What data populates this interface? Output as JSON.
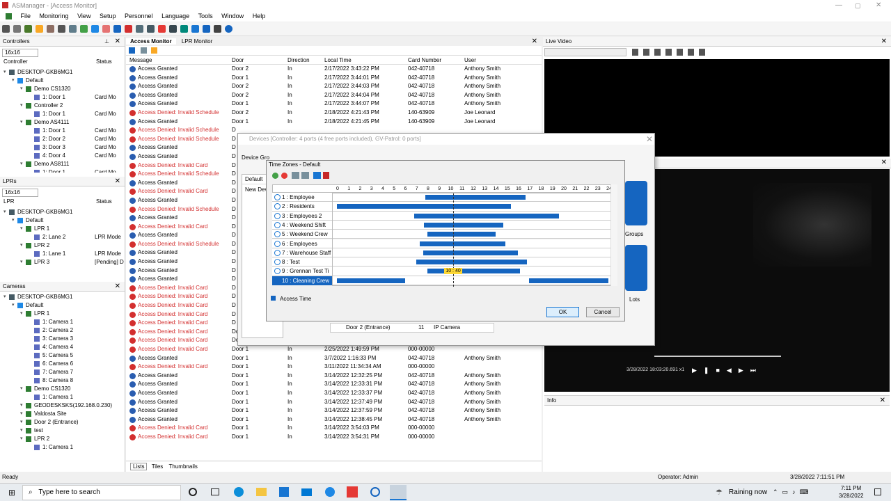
{
  "app": {
    "title": "ASManager - [Access Monitor]"
  },
  "menu": [
    "File",
    "Monitoring",
    "View",
    "Setup",
    "Personnel",
    "Language",
    "Tools",
    "Window",
    "Help"
  ],
  "controllers": {
    "title": "Controllers",
    "size": "16x16",
    "col_controller": "Controller",
    "col_status": "Status",
    "rows": [
      {
        "t": "DESKTOP-GKB6MG1",
        "s": "",
        "l": 0
      },
      {
        "t": "Default",
        "s": "",
        "l": 1
      },
      {
        "t": "Demo CS1320",
        "s": "",
        "l": 2
      },
      {
        "t": "1: Door 1",
        "s": "Card Mo",
        "l": 3
      },
      {
        "t": "Controller 2",
        "s": "",
        "l": 2
      },
      {
        "t": "1: Door 1",
        "s": "Card Mo",
        "l": 3
      },
      {
        "t": "Demo AS4111",
        "s": "",
        "l": 2
      },
      {
        "t": "1: Door 1",
        "s": "Card Mo",
        "l": 3
      },
      {
        "t": "2: Door 2",
        "s": "Card Mo",
        "l": 3
      },
      {
        "t": "3: Door 3",
        "s": "Card Mo",
        "l": 3
      },
      {
        "t": "4: Door 4",
        "s": "Card Mo",
        "l": 3
      },
      {
        "t": "Demo AS8111",
        "s": "",
        "l": 2
      },
      {
        "t": "1: Door 1",
        "s": "Card Mo",
        "l": 3
      }
    ]
  },
  "lprs": {
    "title": "LPRs",
    "size": "16x16",
    "col_lpr": "LPR",
    "col_status": "Status",
    "rows": [
      {
        "t": "DESKTOP-GKB6MG1",
        "s": "",
        "l": 0
      },
      {
        "t": "Default",
        "s": "",
        "l": 1
      },
      {
        "t": "LPR 1",
        "s": "",
        "l": 2
      },
      {
        "t": "2: Lane 2",
        "s": "LPR Mode",
        "l": 3
      },
      {
        "t": "LPR 2",
        "s": "",
        "l": 2
      },
      {
        "t": "1: Lane 1",
        "s": "LPR Mode",
        "l": 3
      },
      {
        "t": "LPR 3",
        "s": "[Pending] D",
        "l": 2
      }
    ]
  },
  "cameras": {
    "title": "Cameras",
    "rows": [
      {
        "t": "DESKTOP-GKB6MG1",
        "l": 0
      },
      {
        "t": "Default",
        "l": 1
      },
      {
        "t": "LPR 1",
        "l": 2
      },
      {
        "t": "1: Camera 1",
        "l": 3
      },
      {
        "t": "2: Camera 2",
        "l": 3
      },
      {
        "t": "3: Camera 3",
        "l": 3
      },
      {
        "t": "4: Camera 4",
        "l": 3
      },
      {
        "t": "5: Camera 5",
        "l": 3
      },
      {
        "t": "6: Camera 6",
        "l": 3
      },
      {
        "t": "7: Camera 7",
        "l": 3
      },
      {
        "t": "8: Camera 8",
        "l": 3
      },
      {
        "t": "Demo CS1320",
        "l": 2
      },
      {
        "t": "1: Camera 1",
        "l": 3
      },
      {
        "t": "GEODESKSKS(192.168.0.230)",
        "l": 2
      },
      {
        "t": "Valdosta Site",
        "l": 2
      },
      {
        "t": "Door 2 (Entrance)",
        "l": 2
      },
      {
        "t": "test",
        "l": 2
      },
      {
        "t": "LPR 2",
        "l": 2
      },
      {
        "t": "1: Camera 1",
        "l": 3
      }
    ]
  },
  "monitor": {
    "tab1": "Access Monitor",
    "tab2": "LPR Monitor",
    "cols": [
      "Message",
      "Door",
      "Direction",
      "Local Time",
      "Card Number",
      "User"
    ],
    "rows": [
      [
        "ok",
        "Access Granted",
        "Door 2",
        "In",
        "2/17/2022 3:43:22 PM",
        "042-40718",
        "Anthony Smith"
      ],
      [
        "ok",
        "Access Granted",
        "Door 1",
        "In",
        "2/17/2022 3:44:01 PM",
        "042-40718",
        "Anthony Smith"
      ],
      [
        "ok",
        "Access Granted",
        "Door 2",
        "In",
        "2/17/2022 3:44:03 PM",
        "042-40718",
        "Anthony Smith"
      ],
      [
        "ok",
        "Access Granted",
        "Door 2",
        "In",
        "2/17/2022 3:44:04 PM",
        "042-40718",
        "Anthony Smith"
      ],
      [
        "ok",
        "Access Granted",
        "Door 1",
        "In",
        "2/17/2022 3:44:07 PM",
        "042-40718",
        "Anthony Smith"
      ],
      [
        "bad",
        "Access Denied: Invalid Schedule",
        "Door 2",
        "In",
        "2/18/2022 4:21:43 PM",
        "140-63909",
        "Joe Leonard"
      ],
      [
        "ok",
        "Access Granted",
        "Door 1",
        "In",
        "2/18/2022 4:21:45 PM",
        "140-63909",
        "Joe Leonard"
      ],
      [
        "bad",
        "Access Denied: Invalid Schedule",
        "D",
        "",
        "",
        "",
        ""
      ],
      [
        "bad",
        "Access Denied: Invalid Schedule",
        "D",
        "",
        "",
        "",
        ""
      ],
      [
        "ok",
        "Access Granted",
        "D",
        "",
        "",
        "",
        ""
      ],
      [
        "ok",
        "Access Granted",
        "D",
        "",
        "",
        "",
        ""
      ],
      [
        "bad",
        "Access Denied: Invalid Card",
        "D",
        "",
        "",
        "",
        ""
      ],
      [
        "bad",
        "Access Denied: Invalid Schedule",
        "D",
        "",
        "",
        "",
        ""
      ],
      [
        "ok",
        "Access Granted",
        "D",
        "",
        "",
        "",
        ""
      ],
      [
        "bad",
        "Access Denied: Invalid Card",
        "D",
        "",
        "",
        "",
        ""
      ],
      [
        "ok",
        "Access Granted",
        "D",
        "",
        "",
        "",
        ""
      ],
      [
        "bad",
        "Access Denied: Invalid Schedule",
        "D",
        "",
        "",
        "",
        ""
      ],
      [
        "ok",
        "Access Granted",
        "D",
        "",
        "",
        "",
        ""
      ],
      [
        "bad",
        "Access Denied: Invalid Card",
        "D",
        "",
        "",
        "",
        ""
      ],
      [
        "ok",
        "Access Granted",
        "D",
        "",
        "",
        "",
        ""
      ],
      [
        "bad",
        "Access Denied: Invalid Schedule",
        "D",
        "",
        "",
        "",
        ""
      ],
      [
        "ok",
        "Access Granted",
        "D",
        "",
        "",
        "",
        ""
      ],
      [
        "ok",
        "Access Granted",
        "D",
        "",
        "",
        "",
        ""
      ],
      [
        "ok",
        "Access Granted",
        "D",
        "",
        "",
        "",
        ""
      ],
      [
        "ok",
        "Access Granted",
        "D",
        "",
        "",
        "",
        ""
      ],
      [
        "bad",
        "Access Denied: Invalid Card",
        "D",
        "",
        "",
        "",
        ""
      ],
      [
        "bad",
        "Access Denied: Invalid Card",
        "D",
        "",
        "",
        "",
        ""
      ],
      [
        "bad",
        "Access Denied: Invalid Card",
        "D",
        "",
        "",
        "",
        ""
      ],
      [
        "bad",
        "Access Denied: Invalid Card",
        "D",
        "",
        "",
        "",
        ""
      ],
      [
        "bad",
        "Access Denied: Invalid Card",
        "D",
        "",
        "",
        "",
        ""
      ],
      [
        "bad",
        "Access Denied: Invalid Card",
        "Door 1",
        "In",
        "2/25/2022 11:59:00 AM",
        "000-00000",
        ""
      ],
      [
        "bad",
        "Access Denied: Invalid Card",
        "Door 1",
        "In",
        "2/25/2022 1:49:50 PM",
        "000-00000",
        ""
      ],
      [
        "bad",
        "Access Denied: Invalid Card",
        "Door 1",
        "In",
        "2/25/2022 1:49:59 PM",
        "000-00000",
        ""
      ],
      [
        "ok",
        "Access Granted",
        "Door 1",
        "In",
        "3/7/2022 1:16:33 PM",
        "042-40718",
        "Anthony Smith"
      ],
      [
        "bad",
        "Access Denied: Invalid Card",
        "Door 1",
        "In",
        "3/11/2022 11:34:34 AM",
        "000-00000",
        ""
      ],
      [
        "ok",
        "Access Granted",
        "Door 1",
        "In",
        "3/14/2022 12:32:25 PM",
        "042-40718",
        "Anthony Smith"
      ],
      [
        "ok",
        "Access Granted",
        "Door 1",
        "In",
        "3/14/2022 12:33:31 PM",
        "042-40718",
        "Anthony Smith"
      ],
      [
        "ok",
        "Access Granted",
        "Door 1",
        "In",
        "3/14/2022 12:33:37 PM",
        "042-40718",
        "Anthony Smith"
      ],
      [
        "ok",
        "Access Granted",
        "Door 1",
        "In",
        "3/14/2022 12:37:49 PM",
        "042-40718",
        "Anthony Smith"
      ],
      [
        "ok",
        "Access Granted",
        "Door 1",
        "In",
        "3/14/2022 12:37:59 PM",
        "042-40718",
        "Anthony Smith"
      ],
      [
        "ok",
        "Access Granted",
        "Door 1",
        "In",
        "3/14/2022 12:38:45 PM",
        "042-40718",
        "Anthony Smith"
      ],
      [
        "bad",
        "Access Denied: Invalid Card",
        "Door 1",
        "In",
        "3/14/2022 3:54:03 PM",
        "000-00000",
        ""
      ],
      [
        "bad",
        "Access Denied: Invalid Card",
        "Door 1",
        "In",
        "3/14/2022 3:54:31 PM",
        "000-00000",
        ""
      ]
    ],
    "bottom_tabs": [
      "Lists",
      "Tiles",
      "Thumbnails"
    ]
  },
  "devices": {
    "title": "Devices  [Controller: 4 ports (4 free ports included), GV-Patrol: 0 ports]",
    "device_group": "Device Gro",
    "default": "Default",
    "new_device": "New Devic",
    "groups_label": "Groups",
    "lots_label": "Lots",
    "row_device": "Door 2 (Entrance)",
    "row_num": "11",
    "row_type": "IP Camera"
  },
  "timezones": {
    "title": "Time Zones - Default",
    "hours": [
      "0",
      "1",
      "2",
      "3",
      "4",
      "5",
      "6",
      "7",
      "8",
      "9",
      "10",
      "11",
      "12",
      "13",
      "14",
      "15",
      "16",
      "17",
      "18",
      "19",
      "20",
      "21",
      "22",
      "23",
      "24"
    ],
    "now_label": "10 : 40",
    "rows": [
      {
        "label": "1 : Employee",
        "ranges": [
          [
            7.8,
            16.7
          ]
        ]
      },
      {
        "label": "2 : Residents",
        "ranges": [
          [
            0,
            15.4
          ]
        ]
      },
      {
        "label": "3 : Employees 2",
        "ranges": [
          [
            6.8,
            19.6
          ]
        ]
      },
      {
        "label": "4 : Weekend Shift",
        "ranges": [
          [
            7.7,
            14.7
          ]
        ]
      },
      {
        "label": "5 : Weekend Crew",
        "ranges": [
          [
            8.0,
            14.0
          ]
        ]
      },
      {
        "label": "6 : Employees",
        "ranges": [
          [
            7.3,
            14.9
          ]
        ]
      },
      {
        "label": "7 : Warehouse Staff",
        "ranges": [
          [
            7.6,
            16.0
          ]
        ]
      },
      {
        "label": "8 : Test",
        "ranges": [
          [
            7.0,
            16.8
          ]
        ]
      },
      {
        "label": "9 : Grennan Test Ti",
        "ranges": [
          [
            8.0,
            16.2
          ]
        ]
      },
      {
        "label": "10 : Cleaning Crew",
        "ranges": [
          [
            0,
            6.0
          ],
          [
            17.0,
            24.0
          ]
        ]
      }
    ],
    "selected_index": 9,
    "legend": "Access Time",
    "ok": "OK",
    "cancel": "Cancel",
    "bar_color": "#1565c0"
  },
  "live": {
    "title": "Live Video",
    "timestamp": "3/28/2022 18:03:20.691 x1",
    "info": "Info"
  },
  "status": {
    "left": "Ready",
    "operator": "Operator: Admin",
    "datetime": "3/28/2022 7:11:51 PM"
  },
  "taskbar": {
    "search": "Type here to search",
    "weather": "Raining now",
    "time": "7:11 PM",
    "date": "3/28/2022"
  }
}
